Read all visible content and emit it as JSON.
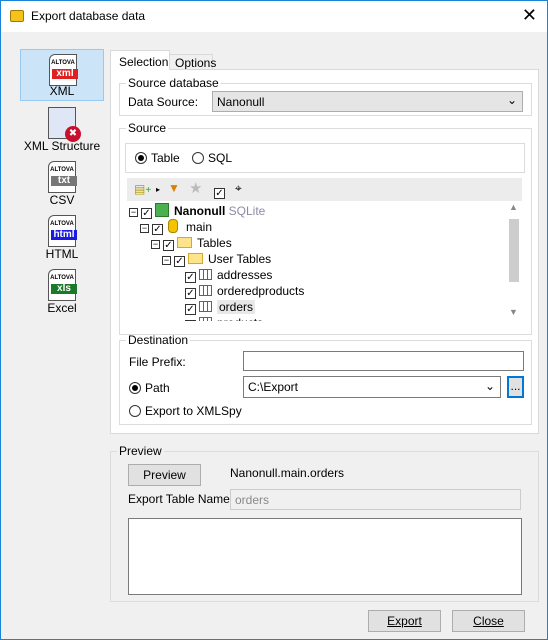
{
  "window": {
    "title": "Export database data"
  },
  "sidebar": {
    "items": [
      {
        "label": "XML",
        "badge": "xml",
        "color": "#e02020",
        "selected": true
      },
      {
        "label": "XML Structure",
        "badge": "",
        "color": "#c8102e"
      },
      {
        "label": "CSV",
        "badge": "txt",
        "color": "#777777"
      },
      {
        "label": "HTML",
        "badge": "html",
        "color": "#1a1ae0"
      },
      {
        "label": "Excel",
        "badge": "xls",
        "color": "#1a7a2a"
      }
    ],
    "brand": "ALTOVA"
  },
  "tabs": [
    {
      "label": "Selection",
      "active": true
    },
    {
      "label": "Options"
    }
  ],
  "source_database": {
    "legend": "Source database",
    "label": "Data Source:",
    "value": "Nanonull"
  },
  "source": {
    "legend": "Source",
    "radio_table": "Table",
    "radio_sql": "SQL",
    "selected": "Table",
    "tree": [
      {
        "label": "Nanonull",
        "suffix": "SQLite",
        "level": 0
      },
      {
        "label": "main",
        "level": 1
      },
      {
        "label": "Tables",
        "level": 2
      },
      {
        "label": "User Tables",
        "level": 3
      },
      {
        "label": "addresses",
        "level": 4
      },
      {
        "label": "orderedproducts",
        "level": 4
      },
      {
        "label": "orders",
        "level": 4,
        "selected": true
      },
      {
        "label": "products",
        "level": 4
      }
    ]
  },
  "destination": {
    "legend": "Destination",
    "file_prefix_label": "File Prefix:",
    "file_prefix": "",
    "path_label": "Path",
    "path": "C:\\Export",
    "browse": "...",
    "xmlspy_label": "Export to XMLSpy",
    "selected": "Path"
  },
  "preview": {
    "legend": "Preview",
    "button": "Preview",
    "table_path": "Nanonull.main.orders",
    "export_name_label": "Export Table Name:",
    "export_name": "orders"
  },
  "footer": {
    "export": "Export",
    "close": "Close"
  }
}
